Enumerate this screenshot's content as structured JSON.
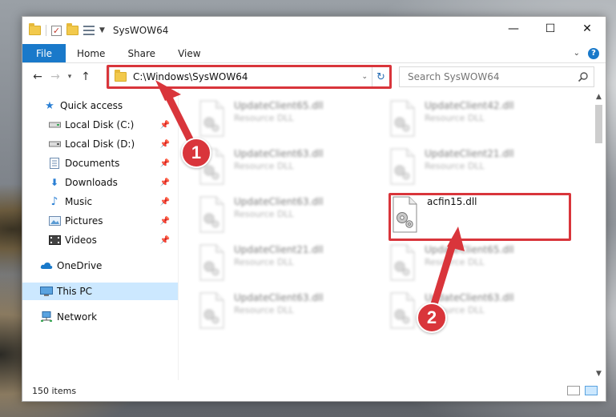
{
  "window": {
    "title": "SysWOW64"
  },
  "ribbon": {
    "file": "File",
    "tabs": [
      "Home",
      "Share",
      "View"
    ],
    "help": "?"
  },
  "window_controls": {
    "minimize": "—",
    "maximize": "☐",
    "close": "✕"
  },
  "address": {
    "path": "C:\\Windows\\SysWOW64",
    "search_placeholder": "Search SysWOW64"
  },
  "nav": {
    "items": [
      {
        "label": "Quick access",
        "icon": "star-icon",
        "pinned": false
      },
      {
        "label": "Local Disk (C:)",
        "icon": "drive-icon",
        "pinned": true
      },
      {
        "label": "Local Disk (D:)",
        "icon": "drive-icon",
        "pinned": true
      },
      {
        "label": "Documents",
        "icon": "documents-icon",
        "pinned": true
      },
      {
        "label": "Downloads",
        "icon": "download-icon",
        "pinned": true
      },
      {
        "label": "Music",
        "icon": "music-icon",
        "pinned": true
      },
      {
        "label": "Pictures",
        "icon": "pictures-icon",
        "pinned": true
      },
      {
        "label": "Videos",
        "icon": "videos-icon",
        "pinned": true
      },
      {
        "label": "OneDrive",
        "icon": "cloud-icon",
        "pinned": false
      },
      {
        "label": "This PC",
        "icon": "computer-icon",
        "pinned": false,
        "selected": true
      },
      {
        "label": "Network",
        "icon": "network-icon",
        "pinned": false
      }
    ]
  },
  "files": [
    {
      "name": "UpdateClient65.dll",
      "type": "Resource DLL"
    },
    {
      "name": "UpdateClient42.dll",
      "type": "Resource DLL"
    },
    {
      "name": "UpdateClient63.dll",
      "type": "Resource DLL"
    },
    {
      "name": "UpdateClient21.dll",
      "type": "Resource DLL"
    },
    {
      "name": "UpdateClient63.dll",
      "type": "Resource DLL"
    },
    {
      "name": "acfin15.dll",
      "type": ""
    },
    {
      "name": "UpdateClient21.dll",
      "type": "Resource DLL"
    },
    {
      "name": "UpdateClient65.dll",
      "type": "Resource DLL"
    },
    {
      "name": "UpdateClient63.dll",
      "type": "Resource DLL"
    },
    {
      "name": "UpdateClient63.dll",
      "type": "Resource DLL"
    }
  ],
  "status": {
    "items_count": "150 items"
  },
  "annotations": {
    "step1": "1",
    "step2": "2"
  },
  "colors": {
    "accent": "#1979ca",
    "highlight": "#d9353b",
    "selection": "#cce8ff"
  }
}
